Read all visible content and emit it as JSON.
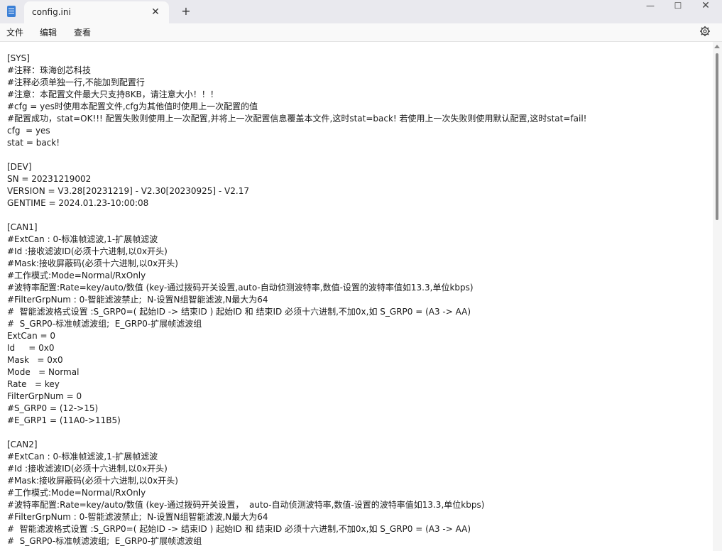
{
  "tab": {
    "title": "config.ini",
    "close": "✕",
    "new": "+"
  },
  "window_controls": {
    "minimize": "—",
    "maximize": "☐",
    "close": "✕"
  },
  "menu": {
    "file": "文件",
    "edit": "编辑",
    "view": "查看"
  },
  "lines": [
    "[SYS]",
    "#注释：珠海创芯科技",
    "#注释必须单独一行,不能加到配置行",
    "#注意：本配置文件最大只支持8KB，请注意大小！！！",
    "#cfg = yes时使用本配置文件,cfg为其他值时使用上一次配置的值",
    "#配置成功，stat=OK!!! 配置失败则使用上一次配置,并将上一次配置信息覆盖本文件,这时stat=back! 若使用上一次失败则使用默认配置,这时stat=fail!",
    "cfg  = yes",
    "stat = back!",
    "",
    "[DEV]",
    "SN = 20231219002",
    "VERSION = V3.28[20231219] - V2.30[20230925] - V2.17",
    "GENTIME = 2024.01.23-10:00:08",
    "",
    "[CAN1]",
    "#ExtCan : 0-标准帧滤波,1-扩展帧滤波",
    "#Id :接收滤波ID(必须十六进制,以0x开头)",
    "#Mask:接收屏蔽码(必须十六进制,以0x开头)",
    "#工作模式:Mode=Normal/RxOnly",
    "#波特率配置:Rate=key/auto/数值 (key-通过拨码开关设置,auto-自动侦测波特率,数值-设置的波特率值如13.3,单位kbps)",
    "#FilterGrpNum : 0-智能滤波禁止;  N-设置N组智能滤波,N最大为64",
    "#  智能滤波格式设置 :S_GRP0=( 起始ID -> 结束ID ) 起始ID 和 结束ID 必须十六进制,不加0x,如 S_GRP0 = (A3 -> AA)",
    "#  S_GRP0-标准帧滤波组;  E_GRP0-扩展帧滤波组",
    "ExtCan = 0",
    "Id     = 0x0",
    "Mask   = 0x0",
    "Mode   = Normal",
    "Rate   = key",
    "FilterGrpNum = 0",
    "#S_GRP0 = (12->15)",
    "#E_GRP1 = (11A0->11B5)",
    "",
    "[CAN2]",
    "#ExtCan : 0-标准帧滤波,1-扩展帧滤波",
    "#Id :接收滤波ID(必须十六进制,以0x开头)",
    "#Mask:接收屏蔽码(必须十六进制,以0x开头)",
    "#工作模式:Mode=Normal/RxOnly",
    "#波特率配置:Rate=key/auto/数值 (key-通过拨码开关设置，  auto-自动侦测波特率,数值-设置的波特率值如13.3,单位kbps)",
    "#FilterGrpNum : 0-智能滤波禁止;  N-设置N组智能滤波,N最大为64",
    "#  智能滤波格式设置 :S_GRP0=( 起始ID -> 结束ID ) 起始ID 和 结束ID 必须十六进制,不加0x,如 S_GRP0 = (A3 -> AA)",
    "#  S_GRP0-标准帧滤波组;  E_GRP0-扩展帧滤波组"
  ]
}
